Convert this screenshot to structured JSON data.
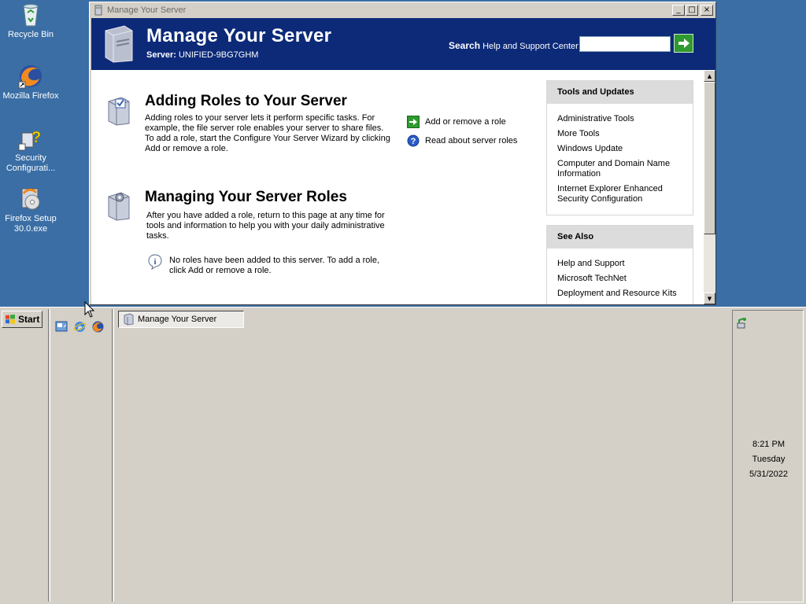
{
  "desktop": {
    "icons": [
      {
        "label": "Recycle Bin",
        "icon": "recycle-bin-icon"
      },
      {
        "label": "Mozilla Firefox",
        "icon": "firefox-icon"
      },
      {
        "label": "Security Configurati...",
        "icon": "security-config-icon"
      },
      {
        "label": "Firefox Setup 30.0.exe",
        "icon": "firefox-setup-icon"
      }
    ]
  },
  "window": {
    "title": "Manage Your Server",
    "controls": {
      "minimize": "_",
      "maximize": "□",
      "close": "×"
    },
    "banner": {
      "title": "Manage Your Server",
      "server_label": "Server:",
      "server_name": "UNIFIED-9BG7GHM",
      "search_bold": "Search",
      "search_rest": "Help and Support Center",
      "search_value": ""
    },
    "sections": [
      {
        "title": "Adding Roles to Your Server",
        "description": "Adding roles to your server lets it perform specific tasks. For example, the file server role enables your server to share files. To add a role, start the Configure Your Server Wizard by clicking Add or remove a role.",
        "links": [
          {
            "label": "Add or remove a role",
            "icon": "green-arrow-icon"
          },
          {
            "label": "Read about server roles",
            "icon": "help-question-icon"
          }
        ]
      },
      {
        "title": "Managing Your Server Roles",
        "description": "After you have added a role, return to this page at any time for tools and information to help you with your daily administrative tasks.",
        "info": "No roles have been added to this server. To add a role, click Add or remove a role."
      }
    ],
    "panels": {
      "tools": {
        "header": "Tools and Updates",
        "items": [
          "Administrative Tools",
          "More Tools",
          "Windows Update",
          "Computer and Domain Name Information",
          "Internet Explorer Enhanced Security Configuration"
        ]
      },
      "see_also": {
        "header": "See Also",
        "items": [
          "Help and Support",
          "Microsoft TechNet",
          "Deployment and Resource Kits"
        ]
      }
    }
  },
  "taskbar": {
    "start_label": "Start",
    "quick_launch": [
      "show-desktop-icon",
      "internet-explorer-icon",
      "firefox-icon"
    ],
    "task_button": "Manage Your Server",
    "clock": {
      "time": "8:21 PM",
      "day": "Tuesday",
      "date": "5/31/2022"
    }
  },
  "colors": {
    "desktop": "#3a6ea5",
    "banner": "#0c2a78",
    "chrome": "#d4d0c8"
  }
}
